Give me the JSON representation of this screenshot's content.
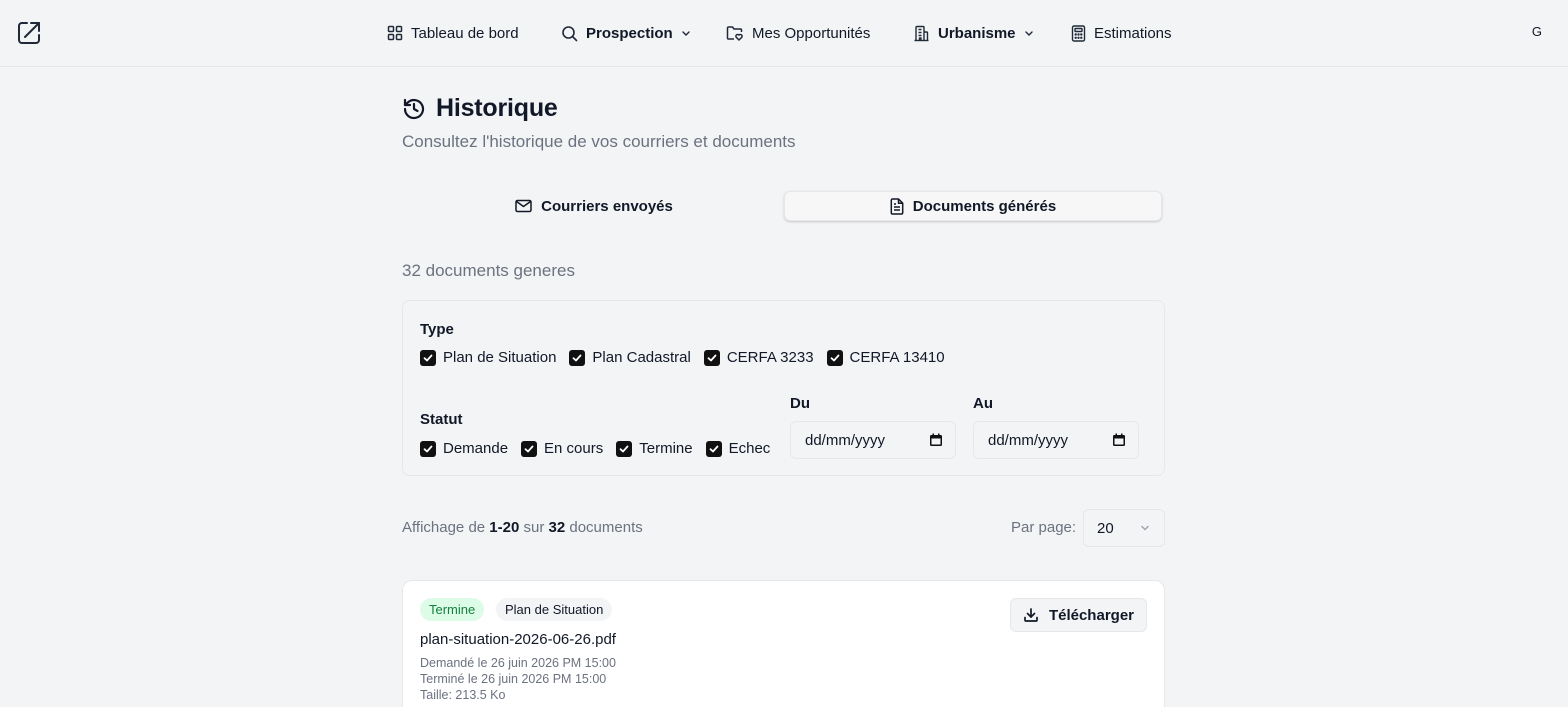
{
  "nav": {
    "items": [
      {
        "label": "Tableau de bord",
        "icon": "dashboard-grid-icon",
        "bold": false
      },
      {
        "label": "Prospection",
        "icon": "search-icon",
        "bold": true,
        "dropdown": true
      },
      {
        "label": "Mes Opportunités",
        "icon": "folder-heart-icon",
        "bold": false
      },
      {
        "label": "Urbanisme",
        "icon": "building-icon",
        "bold": true,
        "dropdown": true
      },
      {
        "label": "Estimations",
        "icon": "calculator-icon",
        "bold": false
      }
    ],
    "avatar": "G"
  },
  "page": {
    "title": "Historique",
    "subtitle": "Consultez l'historique de vos courriers et documents"
  },
  "tabs": [
    {
      "label": "Courriers envoyés",
      "icon": "mail-icon",
      "active": false
    },
    {
      "label": "Documents générés",
      "icon": "file-text-icon",
      "active": true
    }
  ],
  "doc_count": "32 documents generes",
  "filters": {
    "type_label": "Type",
    "types": [
      "Plan de Situation",
      "Plan Cadastral",
      "CERFA 3233",
      "CERFA 13410"
    ],
    "status_label": "Statut",
    "statuses": [
      "Demande",
      "En cours",
      "Termine",
      "Echec"
    ],
    "from_label": "Du",
    "to_label": "Au",
    "date_placeholder": "dd/mm/yyyy"
  },
  "pagination": {
    "prefix": "Affichage de",
    "range": "1-20",
    "middle": "sur",
    "total": "32",
    "suffix": "documents",
    "per_page_label": "Par page:",
    "per_page_value": "20"
  },
  "documents": [
    {
      "status": "Termine",
      "type": "Plan de Situation",
      "filename": "plan-situation-2026-06-26.pdf",
      "requested": "Demandé le 26 juin 2026 PM 15:00",
      "completed": "Terminé le 26 juin 2026 PM 15:00",
      "size": "Taille: 213.5 Ko",
      "download_label": "Télécharger"
    }
  ],
  "colors": {
    "background": "#f3f4f6",
    "success_badge_bg": "#dcfce7",
    "success_badge_text": "#15803d",
    "checkbox": "#111111"
  }
}
